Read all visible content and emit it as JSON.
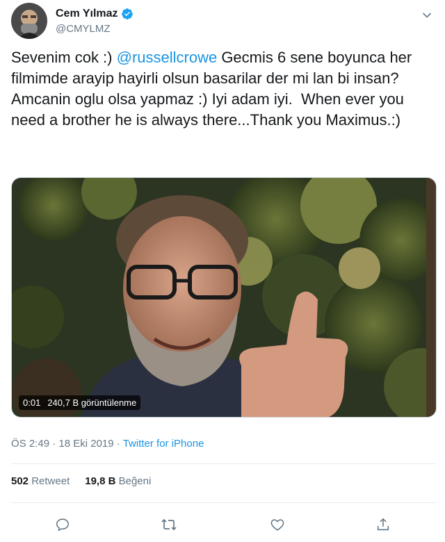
{
  "author": {
    "display_name": "Cem Yılmaz",
    "handle": "@CMYLMZ",
    "verified_icon": "verified-badge-icon",
    "avatar": "avatar"
  },
  "tweet": {
    "text_before": "Sevenim cok :) ",
    "mention": "@russellcrowe",
    "text_after": " Gecmis 6 sene boyunca her filmimde arayip hayirli olsun basarilar der mi lan bi insan? Amcanin oglu olsa yapmaz :) Iyi adam iyi.  When ever you need a brother he is always there...Thank you Maximus.:)"
  },
  "video": {
    "time": "0:01",
    "views": "240,7 B görüntülenme"
  },
  "meta": {
    "time": "ÖS 2:49",
    "separator1": " · ",
    "date": "18 Eki 2019",
    "separator2": " · ",
    "source": "Twitter for iPhone"
  },
  "stats": {
    "retweets_count": "502",
    "retweets_label": "Retweet",
    "likes_count": "19,8 B",
    "likes_label": "Beğeni"
  },
  "icons": {
    "reply": "reply-icon",
    "retweet": "retweet-icon",
    "like": "like-icon",
    "share": "share-icon",
    "caret": "chevron-down-icon"
  },
  "colors": {
    "accent": "#1b95e0",
    "muted": "#657786",
    "text": "#14171a",
    "border": "#e6ecf0"
  }
}
